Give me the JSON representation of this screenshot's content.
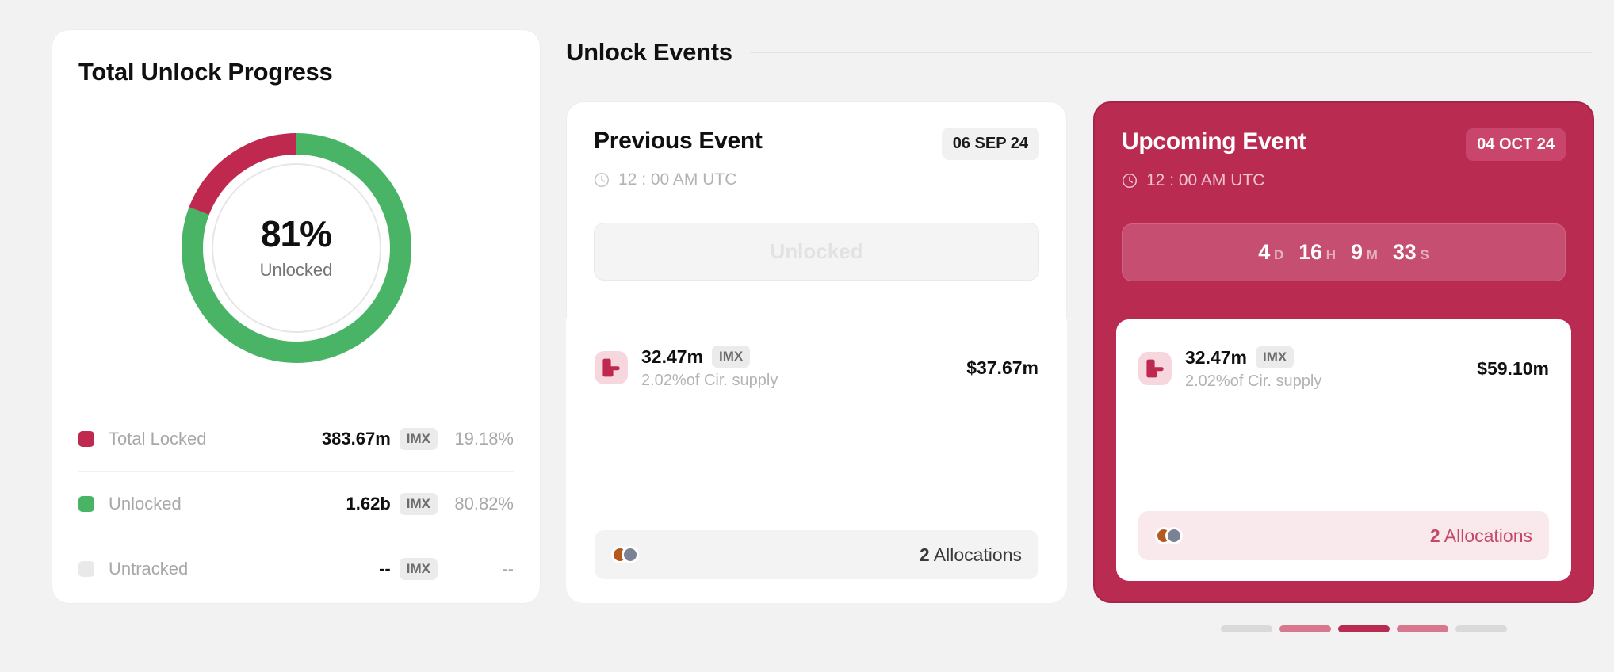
{
  "progress_card": {
    "title": "Total Unlock Progress",
    "donut": {
      "percent_label": "81%",
      "sub_label": "Unlocked"
    },
    "legend": [
      {
        "name": "Total Locked",
        "amount": "383.67m",
        "symbol": "IMX",
        "percent": "19.18%",
        "color": "#c0294f"
      },
      {
        "name": "Unlocked",
        "amount": "1.62b",
        "symbol": "IMX",
        "percent": "80.82%",
        "color": "#49b465"
      },
      {
        "name": "Untracked",
        "amount": "--",
        "symbol": "IMX",
        "percent": "--",
        "color": "#e9e9e9"
      }
    ]
  },
  "events": {
    "section_title": "Unlock Events",
    "previous": {
      "name": "Previous Event",
      "date": "06 SEP 24",
      "time": "12 : 00 AM UTC",
      "status_label": "Unlocked",
      "token": {
        "amount": "32.47m",
        "symbol": "IMX",
        "supply_note": "2.02%of Cir. supply",
        "usd_value": "$37.67m"
      },
      "allocations_count": "2",
      "allocations_label": "Allocations"
    },
    "upcoming": {
      "name": "Upcoming Event",
      "date": "04 OCT 24",
      "time": "12 : 00 AM UTC",
      "countdown": {
        "days": "4",
        "days_unit": "D",
        "hours": "16",
        "hours_unit": "H",
        "minutes": "9",
        "minutes_unit": "M",
        "seconds": "33",
        "seconds_unit": "S"
      },
      "token": {
        "amount": "32.47m",
        "symbol": "IMX",
        "supply_note": "2.02%of Cir. supply",
        "usd_value": "$59.10m"
      },
      "allocations_count": "2",
      "allocations_label": "Allocations"
    }
  },
  "pagination": {
    "items": [
      {
        "color": "#dadada"
      },
      {
        "color": "#d8788f"
      },
      {
        "color": "#b92b51"
      },
      {
        "color": "#d8788f"
      },
      {
        "color": "#dadada"
      }
    ]
  },
  "chart_data": {
    "type": "pie",
    "title": "Total Unlock Progress",
    "categories": [
      "Unlocked",
      "Total Locked",
      "Untracked"
    ],
    "values": [
      80.82,
      19.18,
      0
    ],
    "value_labels": [
      "1.62b IMX",
      "383.67m IMX",
      "-- IMX"
    ],
    "colors": [
      "#49b465",
      "#c0294f",
      "#e9e9e9"
    ],
    "center_label": "81%",
    "center_sublabel": "Unlocked",
    "unit": "%",
    "legend_position": "bottom"
  }
}
